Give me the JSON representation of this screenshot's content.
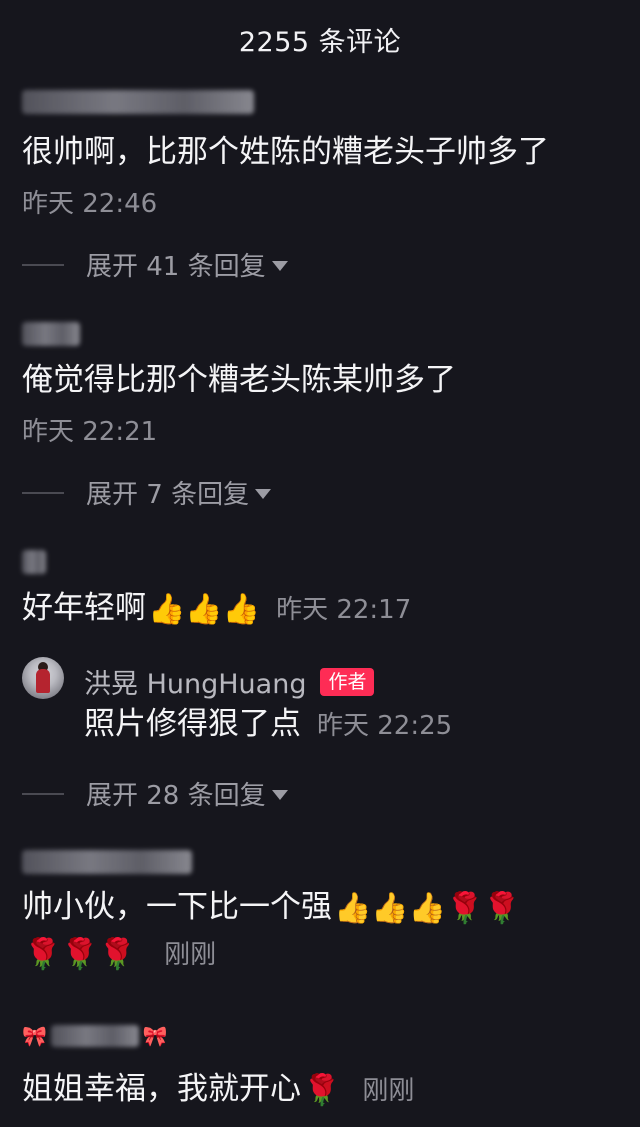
{
  "header": {
    "title": "2255 条评论"
  },
  "comments": [
    {
      "text": "很帅啊，比那个姓陈的糟老头子帅多了",
      "time": "昨天 22:46",
      "expand": "展开 41 条回复"
    },
    {
      "text": "俺觉得比那个糟老头陈某帅多了",
      "time": "昨天 22:21",
      "expand": "展开 7 条回复"
    },
    {
      "text": "好年轻啊",
      "emoji": "👍👍👍",
      "time": "昨天 22:17",
      "reply": {
        "name": "洪晃 HungHuang",
        "badge": "作者",
        "text": "照片修得狠了点",
        "time": "昨天 22:25"
      },
      "expand": "展开 28 条回复"
    },
    {
      "text": "帅小伙，一下比一个强",
      "emoji_line1": "👍👍👍🌹🌹",
      "emoji_line2": "🌹🌹🌹",
      "time": "刚刚"
    },
    {
      "text": "姐姐幸福，我就开心",
      "emoji": "🌹",
      "time": "刚刚"
    }
  ],
  "icons": [
    "chevron-down-icon",
    "thumbs-up-icon",
    "rose-icon",
    "avatar",
    "bow-icon"
  ],
  "colors": {
    "background": "#16161d",
    "badge": "#fe2c55",
    "muted": "#8e8e96"
  }
}
